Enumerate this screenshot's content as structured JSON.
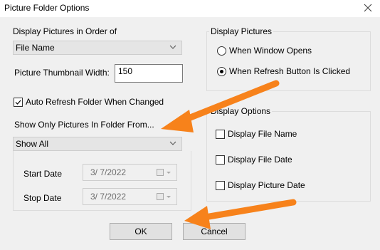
{
  "window": {
    "title": "Picture Folder Options"
  },
  "order": {
    "label": "Display Pictures in Order of",
    "selected": "File Name"
  },
  "thumbnail": {
    "label": "Picture Thumbnail Width:",
    "value": "150"
  },
  "auto_refresh": {
    "label": "Auto Refresh Folder When Changed",
    "checked": true
  },
  "folder_filter": {
    "label": "Show Only Pictures In Folder From...",
    "selected": "Show All",
    "start_label": "Start Date",
    "start_value": "3/  7/2022",
    "stop_label": "Stop Date",
    "stop_value": "3/  7/2022"
  },
  "display_pictures": {
    "label": "Display Pictures",
    "options": [
      "When Window Opens",
      "When Refresh Button Is Clicked"
    ],
    "selected_index": 1
  },
  "display_options": {
    "label": "Display Options",
    "items": [
      "Display File Name",
      "Display File Date",
      "Display Picture Date"
    ]
  },
  "buttons": {
    "ok": "OK",
    "cancel": "Cancel"
  },
  "colors": {
    "arrow": "#f7821b",
    "dialog_bg": "#f0f0f0"
  }
}
